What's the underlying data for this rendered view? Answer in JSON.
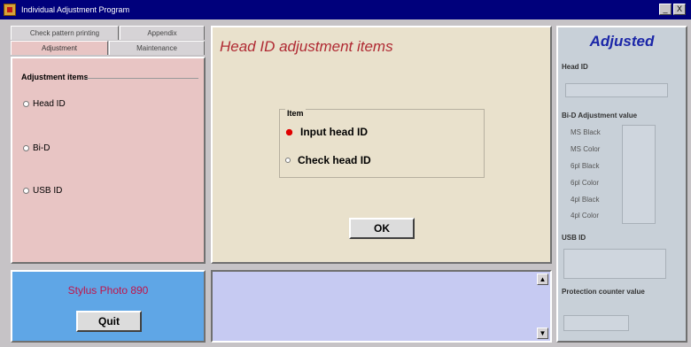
{
  "window": {
    "title": "Individual Adjustment Program",
    "buttons": [
      "_",
      "X"
    ]
  },
  "tabs": [
    {
      "label": "Check pattern printing"
    },
    {
      "label": "Appendix"
    },
    {
      "label": "Adjustment"
    },
    {
      "label": "Maintenance"
    }
  ],
  "adjustment_items": {
    "title": "Adjustment items",
    "items": [
      {
        "label": "Head ID",
        "selected": true
      },
      {
        "label": "Bi-D",
        "selected": false
      },
      {
        "label": "USB ID",
        "selected": false
      }
    ]
  },
  "model": {
    "name": "Stylus Photo 890",
    "quit_label": "Quit"
  },
  "main": {
    "title": "Head ID adjustment items",
    "group_label": "Item",
    "options": [
      {
        "label": "Input head ID",
        "selected": true
      },
      {
        "label": "Check head ID",
        "selected": false
      }
    ],
    "ok_label": "OK"
  },
  "right": {
    "title": "Adjusted",
    "head_id_label": "Head ID",
    "bid_label": "Bi-D Adjustment value",
    "bid_rows": [
      "MS Black",
      "MS Color",
      "6pl Black",
      "6pl Color",
      "4pl Black",
      "4pl Color"
    ],
    "usb_label": "USB ID",
    "protection_label": "Protection counter value"
  },
  "colors": {
    "title_bar": "#00007b",
    "accent_red": "#b02a33",
    "accent_blue": "#1b26a8"
  }
}
